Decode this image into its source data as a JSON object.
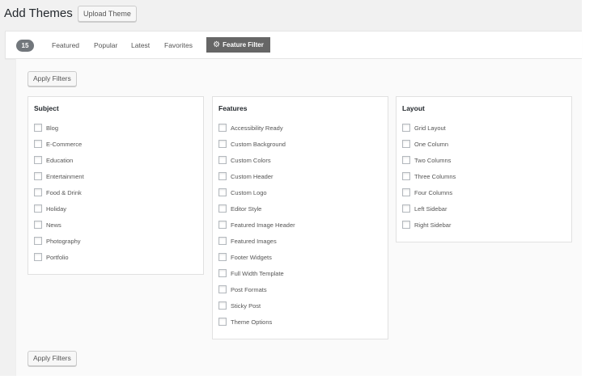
{
  "header": {
    "title": "Add Themes",
    "upload_label": "Upload Theme"
  },
  "filter_bar": {
    "count": "15",
    "links": [
      "Featured",
      "Popular",
      "Latest",
      "Favorites"
    ],
    "feature_filter_label": "Feature Filter",
    "feature_filter_icon": "gear-icon"
  },
  "drawer": {
    "apply_label_top": "Apply Filters",
    "apply_label_bottom": "Apply Filters",
    "subject": {
      "title": "Subject",
      "options": [
        "Blog",
        "E-Commerce",
        "Education",
        "Entertainment",
        "Food & Drink",
        "Holiday",
        "News",
        "Photography",
        "Portfolio"
      ]
    },
    "features": {
      "title": "Features",
      "options": [
        "Accessibility Ready",
        "Custom Background",
        "Custom Colors",
        "Custom Header",
        "Custom Logo",
        "Editor Style",
        "Featured Image Header",
        "Featured Images",
        "Footer Widgets",
        "Full Width Template",
        "Post Formats",
        "Sticky Post",
        "Theme Options"
      ]
    },
    "layout": {
      "title": "Layout",
      "options": [
        "Grid Layout",
        "One Column",
        "Two Columns",
        "Three Columns",
        "Four Columns",
        "Left Sidebar",
        "Right Sidebar"
      ]
    }
  },
  "colors": {
    "background": "#f1f1f1",
    "tab_active": "#666666",
    "badge": "#72777c"
  }
}
